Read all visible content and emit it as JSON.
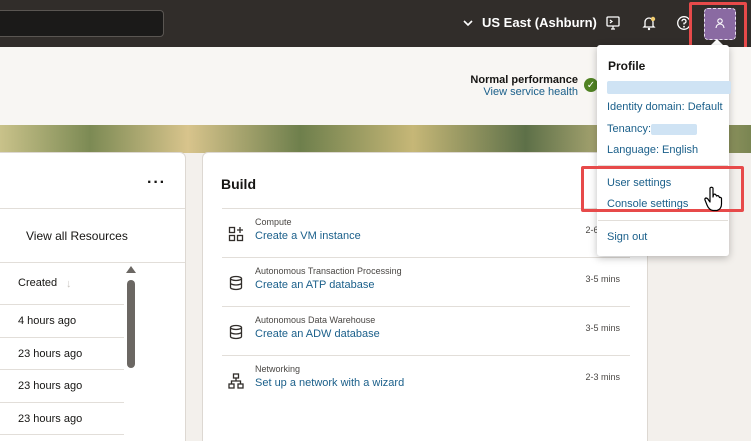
{
  "topbar": {
    "region_label": "US East (Ashburn)",
    "icons": [
      "chevron-down-icon",
      "cloud-shell-icon",
      "notification-bell-icon",
      "help-icon",
      "user-profile-icon"
    ]
  },
  "banner": {
    "performance_status": "Normal performance",
    "performance_link": "View service health"
  },
  "resources": {
    "view_all_label": "View all Resources",
    "more_label": "···",
    "column_created": "Created",
    "rows": [
      "4 hours ago",
      "23 hours ago",
      "23 hours ago",
      "23 hours ago"
    ]
  },
  "build": {
    "title": "Build",
    "items": [
      {
        "category": "Compute",
        "link": "Create a VM instance",
        "time": "2-6 mins",
        "icon": "compute-icon"
      },
      {
        "category": "Autonomous Transaction Processing",
        "link": "Create an ATP database",
        "time": "3-5 mins",
        "icon": "database-icon"
      },
      {
        "category": "Autonomous Data Warehouse",
        "link": "Create an ADW database",
        "time": "3-5 mins",
        "icon": "database-icon"
      },
      {
        "category": "Networking",
        "link": "Set up a network with a wizard",
        "time": "2-3 mins",
        "icon": "network-icon"
      }
    ]
  },
  "profile_menu": {
    "title": "Profile",
    "identity_domain": "Identity domain: Default",
    "tenancy_label": "Tenancy:",
    "language": "Language: English",
    "user_settings": "User settings",
    "console_settings": "Console settings",
    "sign_out": "Sign out"
  },
  "colors": {
    "topbar": "#312d2a",
    "link": "#1a5f8a",
    "highlight": "#e74a4a",
    "avatar": "#8a6aa2",
    "success": "#508223"
  }
}
